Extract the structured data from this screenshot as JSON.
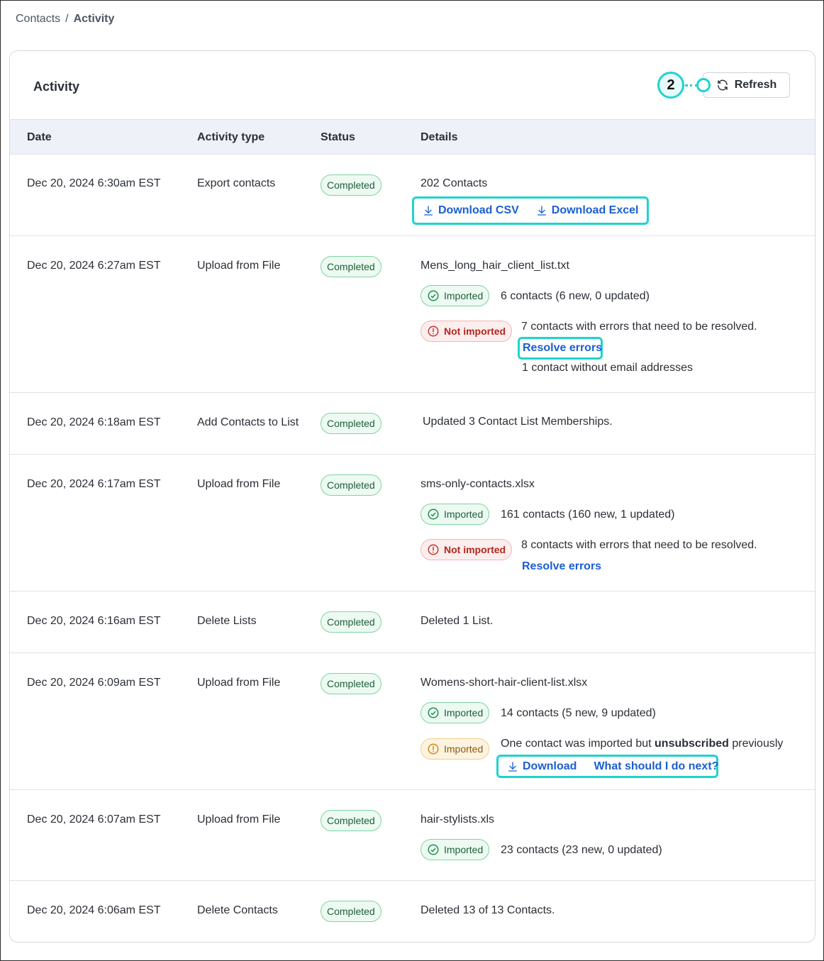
{
  "breadcrumb": {
    "root": "Contacts",
    "separator": "/",
    "current": "Activity"
  },
  "card": {
    "title": "Activity",
    "refresh_label": "Refresh",
    "callout_number": "2"
  },
  "columns": {
    "date": "Date",
    "type": "Activity type",
    "status": "Status",
    "details": "Details"
  },
  "colors": {
    "callout": "#1fd3cf",
    "link": "#1a5fd1",
    "success": "#1f5e3a",
    "error": "#b3261e",
    "warning": "#8a5a0a",
    "header_bg": "#eef1f7"
  },
  "rows": [
    {
      "date": "Dec 20, 2024 6:30am EST",
      "type": "Export contacts",
      "status": "Completed",
      "title": "202 Contacts",
      "download_csv": "Download CSV",
      "download_excel": "Download Excel"
    },
    {
      "date": "Dec 20, 2024 6:27am EST",
      "type": "Upload from File",
      "status": "Completed",
      "title": "Mens_long_hair_client_list.txt",
      "imported_label": "Imported",
      "imported_text": "6 contacts (6 new, 0 updated)",
      "not_imported_label": "Not imported",
      "not_imported_text": "7 contacts with errors that need to be resolved.",
      "resolve_label": "Resolve errors",
      "extra_text": "1 contact without email addresses"
    },
    {
      "date": "Dec 20, 2024 6:18am EST",
      "type": "Add Contacts to List",
      "status": "Completed",
      "title": "Updated 3 Contact List Memberships."
    },
    {
      "date": "Dec 20, 2024 6:17am EST",
      "type": "Upload from File",
      "status": "Completed",
      "title": "sms-only-contacts.xlsx",
      "imported_label": "Imported",
      "imported_text": "161 contacts (160 new, 1 updated)",
      "not_imported_label": "Not imported",
      "not_imported_text": "8 contacts with errors that need to be resolved.",
      "resolve_label": "Resolve errors"
    },
    {
      "date": "Dec 20, 2024 6:16am EST",
      "type": "Delete Lists",
      "status": "Completed",
      "title": "Deleted 1 List."
    },
    {
      "date": "Dec 20, 2024 6:09am EST",
      "type": "Upload from File",
      "status": "Completed",
      "title": "Womens-short-hair-client-list.xlsx",
      "imported_label": "Imported",
      "imported_text": "14 contacts (5 new, 9 updated)",
      "warn_label": "Imported",
      "warn_text_1": "One contact was imported but",
      "warn_text_bold": "unsubscribed",
      "warn_text_2": "previously",
      "download_label": "Download",
      "next_label": "What should I do next?"
    },
    {
      "date": "Dec 20, 2024 6:07am EST",
      "type": "Upload from File",
      "status": "Completed",
      "title": "hair-stylists.xls",
      "imported_label": "Imported",
      "imported_text": "23 contacts (23 new, 0 updated)"
    },
    {
      "date": "Dec 20, 2024 6:06am EST",
      "type": "Delete Contacts",
      "status": "Completed",
      "title": "Deleted 13 of 13 Contacts."
    }
  ]
}
